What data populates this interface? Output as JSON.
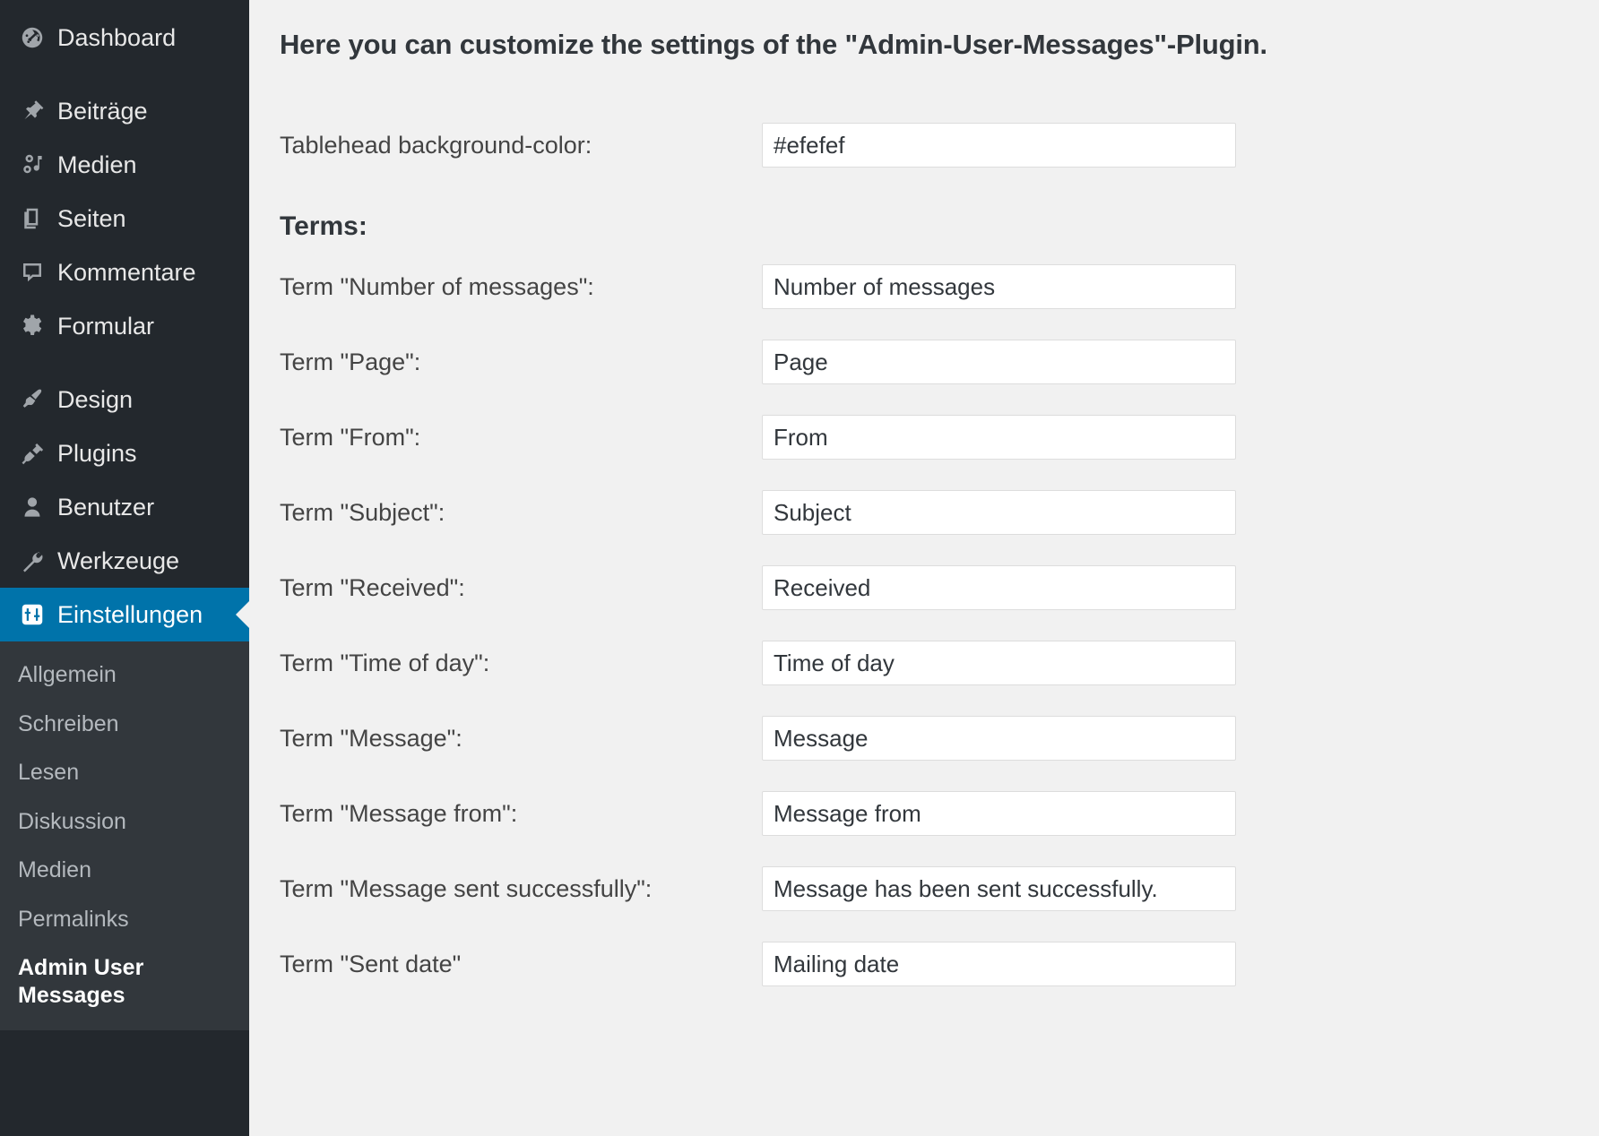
{
  "sidebar": {
    "items": [
      {
        "label": "Dashboard",
        "icon": "dashboard-icon",
        "active": false
      },
      {
        "label": "Beiträge",
        "icon": "pin-icon",
        "active": false
      },
      {
        "label": "Medien",
        "icon": "media-icon",
        "active": false
      },
      {
        "label": "Seiten",
        "icon": "pages-icon",
        "active": false
      },
      {
        "label": "Kommentare",
        "icon": "comment-icon",
        "active": false
      },
      {
        "label": "Formular",
        "icon": "gear-icon",
        "active": false
      },
      {
        "label": "Design",
        "icon": "paintbrush-icon",
        "active": false
      },
      {
        "label": "Plugins",
        "icon": "plug-icon",
        "active": false
      },
      {
        "label": "Benutzer",
        "icon": "user-icon",
        "active": false
      },
      {
        "label": "Werkzeuge",
        "icon": "wrench-icon",
        "active": false
      },
      {
        "label": "Einstellungen",
        "icon": "settings-sliders-icon",
        "active": true
      }
    ],
    "submenu": [
      {
        "label": "Allgemein",
        "current": false
      },
      {
        "label": "Schreiben",
        "current": false
      },
      {
        "label": "Lesen",
        "current": false
      },
      {
        "label": "Diskussion",
        "current": false
      },
      {
        "label": "Medien",
        "current": false
      },
      {
        "label": "Permalinks",
        "current": false
      },
      {
        "label": "Admin User Messages",
        "current": true
      }
    ],
    "accent_color": "#0073aa",
    "background_color": "#23282d",
    "submenu_background_color": "#32373c"
  },
  "main": {
    "page_title": "Here you can customize the settings of the \"Admin-User-Messages\"-Plugin.",
    "tablehead": {
      "label": "Tablehead background-color:",
      "value": "#efefef"
    },
    "terms_heading": "Terms:",
    "terms": [
      {
        "label": "Term \"Number of messages\":",
        "value": "Number of messages"
      },
      {
        "label": "Term \"Page\":",
        "value": "Page"
      },
      {
        "label": "Term \"From\":",
        "value": "From"
      },
      {
        "label": "Term \"Subject\":",
        "value": "Subject"
      },
      {
        "label": "Term \"Received\":",
        "value": "Received"
      },
      {
        "label": "Term \"Time of day\":",
        "value": "Time of day"
      },
      {
        "label": "Term \"Message\":",
        "value": "Message"
      },
      {
        "label": "Term \"Message from\":",
        "value": "Message from"
      },
      {
        "label": "Term \"Message sent successfully\":",
        "value": "Message has been sent successfully."
      },
      {
        "label": "Term \"Sent date\"",
        "value": "Mailing date"
      }
    ]
  }
}
